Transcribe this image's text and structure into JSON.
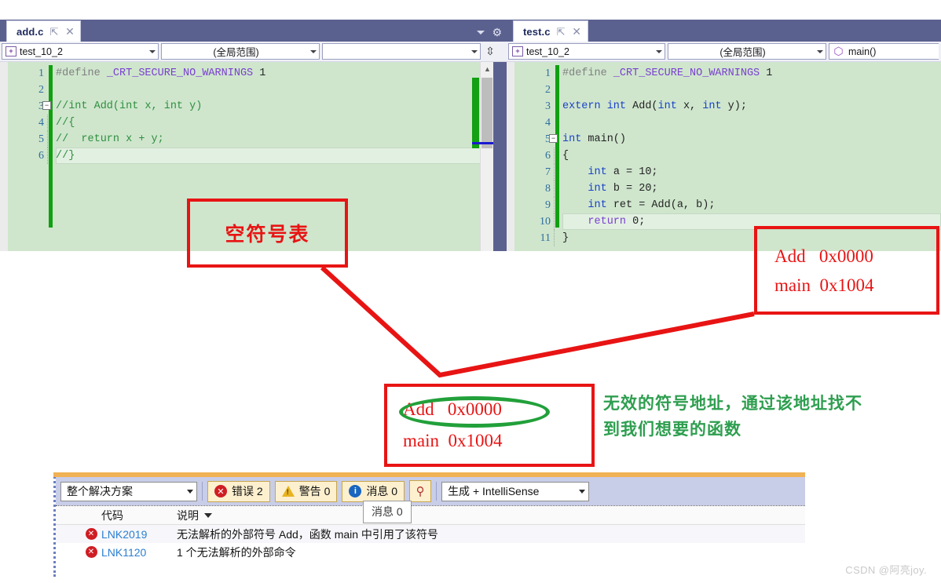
{
  "panes": [
    {
      "tab": {
        "title": "add.c",
        "pin_icon": "pin-icon",
        "close_icon": "close-icon"
      },
      "navbar": {
        "project": "test_10_2",
        "scope": "(全局范围)",
        "member": ""
      },
      "code": {
        "lines": [
          {
            "n": "1",
            "segs": [
              {
                "t": "#define ",
                "c": "pp"
              },
              {
                "t": "_CRT_SECURE_NO_WARNINGS",
                "c": "mac"
              },
              {
                "t": " 1",
                "c": "num"
              }
            ]
          },
          {
            "n": "2",
            "segs": []
          },
          {
            "n": "3",
            "segs": [
              {
                "t": "//int Add(int x, int y)",
                "c": "cmt"
              }
            ],
            "fold": "−"
          },
          {
            "n": "4",
            "segs": [
              {
                "t": "//{",
                "c": "cmt"
              }
            ],
            "guide": true
          },
          {
            "n": "5",
            "segs": [
              {
                "t": "//  return x + y;",
                "c": "cmt"
              }
            ],
            "guide": true
          },
          {
            "n": "6",
            "segs": [
              {
                "t": "//}",
                "c": "cmt"
              }
            ],
            "guide": true,
            "current": true
          }
        ]
      }
    },
    {
      "tab": {
        "title": "test.c",
        "pin_icon": "pin-icon",
        "close_icon": "close-icon"
      },
      "navbar": {
        "project": "test_10_2",
        "scope": "(全局范围)",
        "member": "main()"
      },
      "code": {
        "lines": [
          {
            "n": "1",
            "segs": [
              {
                "t": "#define ",
                "c": "pp"
              },
              {
                "t": "_CRT_SECURE_NO_WARNINGS",
                "c": "mac"
              },
              {
                "t": " 1",
                "c": "num"
              }
            ]
          },
          {
            "n": "2",
            "segs": []
          },
          {
            "n": "3",
            "segs": [
              {
                "t": "extern int ",
                "c": "kw"
              },
              {
                "t": "Add(",
                "c": "ident"
              },
              {
                "t": "int ",
                "c": "kw"
              },
              {
                "t": "x, ",
                "c": "ident"
              },
              {
                "t": "int ",
                "c": "kw"
              },
              {
                "t": "y);",
                "c": "ident"
              }
            ]
          },
          {
            "n": "4",
            "segs": []
          },
          {
            "n": "5",
            "segs": [
              {
                "t": "int ",
                "c": "kw"
              },
              {
                "t": "main()",
                "c": "ident"
              }
            ],
            "fold": "−"
          },
          {
            "n": "6",
            "segs": [
              {
                "t": "{",
                "c": "ident"
              }
            ],
            "guide": true
          },
          {
            "n": "7",
            "segs": [
              {
                "t": "    int ",
                "c": "kw"
              },
              {
                "t": "a = 10;",
                "c": "ident"
              }
            ],
            "guide": true
          },
          {
            "n": "8",
            "segs": [
              {
                "t": "    int ",
                "c": "kw"
              },
              {
                "t": "b = 20;",
                "c": "ident"
              }
            ],
            "guide": true
          },
          {
            "n": "9",
            "segs": [
              {
                "t": "    int ",
                "c": "kw"
              },
              {
                "t": "ret = Add(a, b);",
                "c": "ident"
              }
            ],
            "guide": true
          },
          {
            "n": "10",
            "segs": [
              {
                "t": "    return ",
                "c": "mac"
              },
              {
                "t": "0;",
                "c": "ident"
              }
            ],
            "guide": true,
            "current": true
          },
          {
            "n": "11",
            "segs": [
              {
                "t": "}",
                "c": "ident"
              }
            ],
            "guide": true
          }
        ]
      }
    }
  ],
  "annotations": {
    "empty_symtab": "空符号表",
    "symtab_right": {
      "line1": "Add   0x0000",
      "line2": "main  0x1004"
    },
    "symtab_bottom": {
      "line1": "Add   0x0000",
      "line2": "main  0x1004"
    },
    "note": "无效的符号地址，通过该地址找不到我们想要的函数",
    "colors": {
      "box": "#e81414",
      "ellipse": "#22a03a",
      "note": "#2e9e4f"
    }
  },
  "error_list": {
    "scope_filter": "整个解决方案",
    "build_filter": "生成 + IntelliSense",
    "toggles": [
      {
        "icon": "error-icon",
        "label": "错误 2"
      },
      {
        "icon": "warning-icon",
        "label": "警告 0"
      },
      {
        "icon": "info-icon",
        "label": "消息 0"
      }
    ],
    "tooltip": "消息 0",
    "keypin_icon": "key-pin-icon",
    "columns": {
      "code": "代码",
      "description": "说明"
    },
    "rows": [
      {
        "icon": "error-icon",
        "code": "LNK2019",
        "description": "无法解析的外部符号 Add，函数 main 中引用了该符号"
      },
      {
        "icon": "error-icon",
        "code": "LNK1120",
        "description": "1 个无法解析的外部命令"
      }
    ]
  },
  "watermark": "CSDN @阿亮joy."
}
